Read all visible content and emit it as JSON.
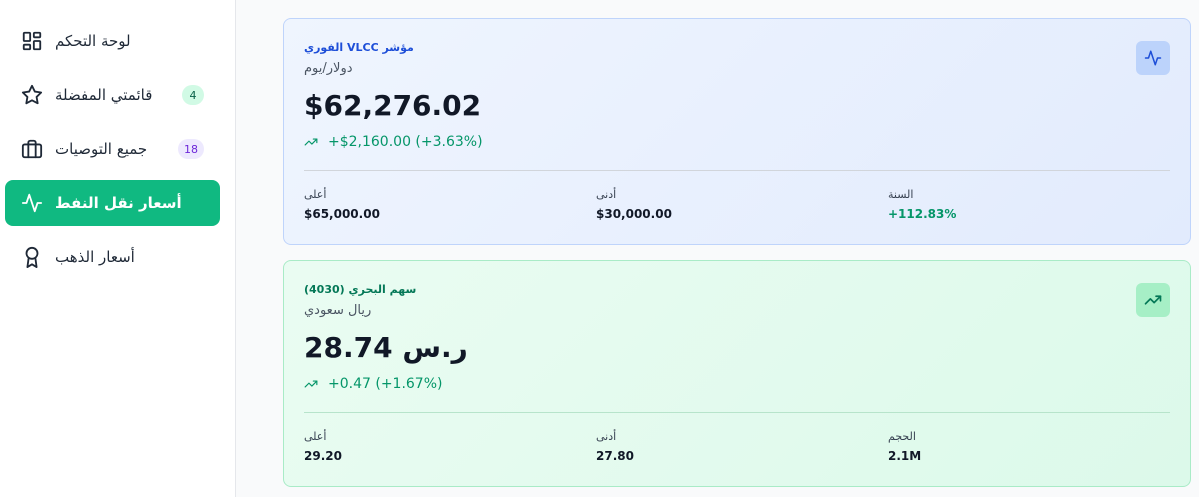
{
  "sidebar": {
    "items": [
      {
        "label": "لوحة التحكم",
        "icon": "dashboard-grid-icon"
      },
      {
        "label": "قائمتي المفضلة",
        "icon": "star-icon",
        "badge": "4"
      },
      {
        "label": "جميع التوصيات",
        "icon": "briefcase-icon",
        "badge": "18"
      },
      {
        "label": "أسعار نقل النفط",
        "icon": "activity-pulse-icon",
        "active": true
      },
      {
        "label": "أسعار الذهب",
        "icon": "award-medal-icon"
      }
    ]
  },
  "cards": [
    {
      "title": "الفوري VLCC مؤشر",
      "subtitle": "دولار/يوم",
      "price": "$62,276.02",
      "change": "+$2,160.00 (+3.63%)",
      "icon": "activity-pulse-icon",
      "stats": [
        {
          "label": "أعلى",
          "value": "$65,000.00"
        },
        {
          "label": "أدنى",
          "value": "$30,000.00"
        },
        {
          "label": "السنة",
          "value": "+112.83%"
        }
      ]
    },
    {
      "title": "سهم البحري (4030)",
      "subtitle": "ريال سعودي",
      "price": "28.74 ر.س",
      "change": "+0.47 (+1.67%)",
      "icon": "trending-up-icon",
      "stats": [
        {
          "label": "أعلى",
          "value": "29.20"
        },
        {
          "label": "أدنى",
          "value": "27.80"
        },
        {
          "label": "الحجم",
          "value": "2.1M"
        }
      ]
    }
  ],
  "colors": {
    "accent": "#10b981",
    "positive": "#059669",
    "oil_title": "#1d4ed8",
    "bahri_title": "#047857"
  }
}
